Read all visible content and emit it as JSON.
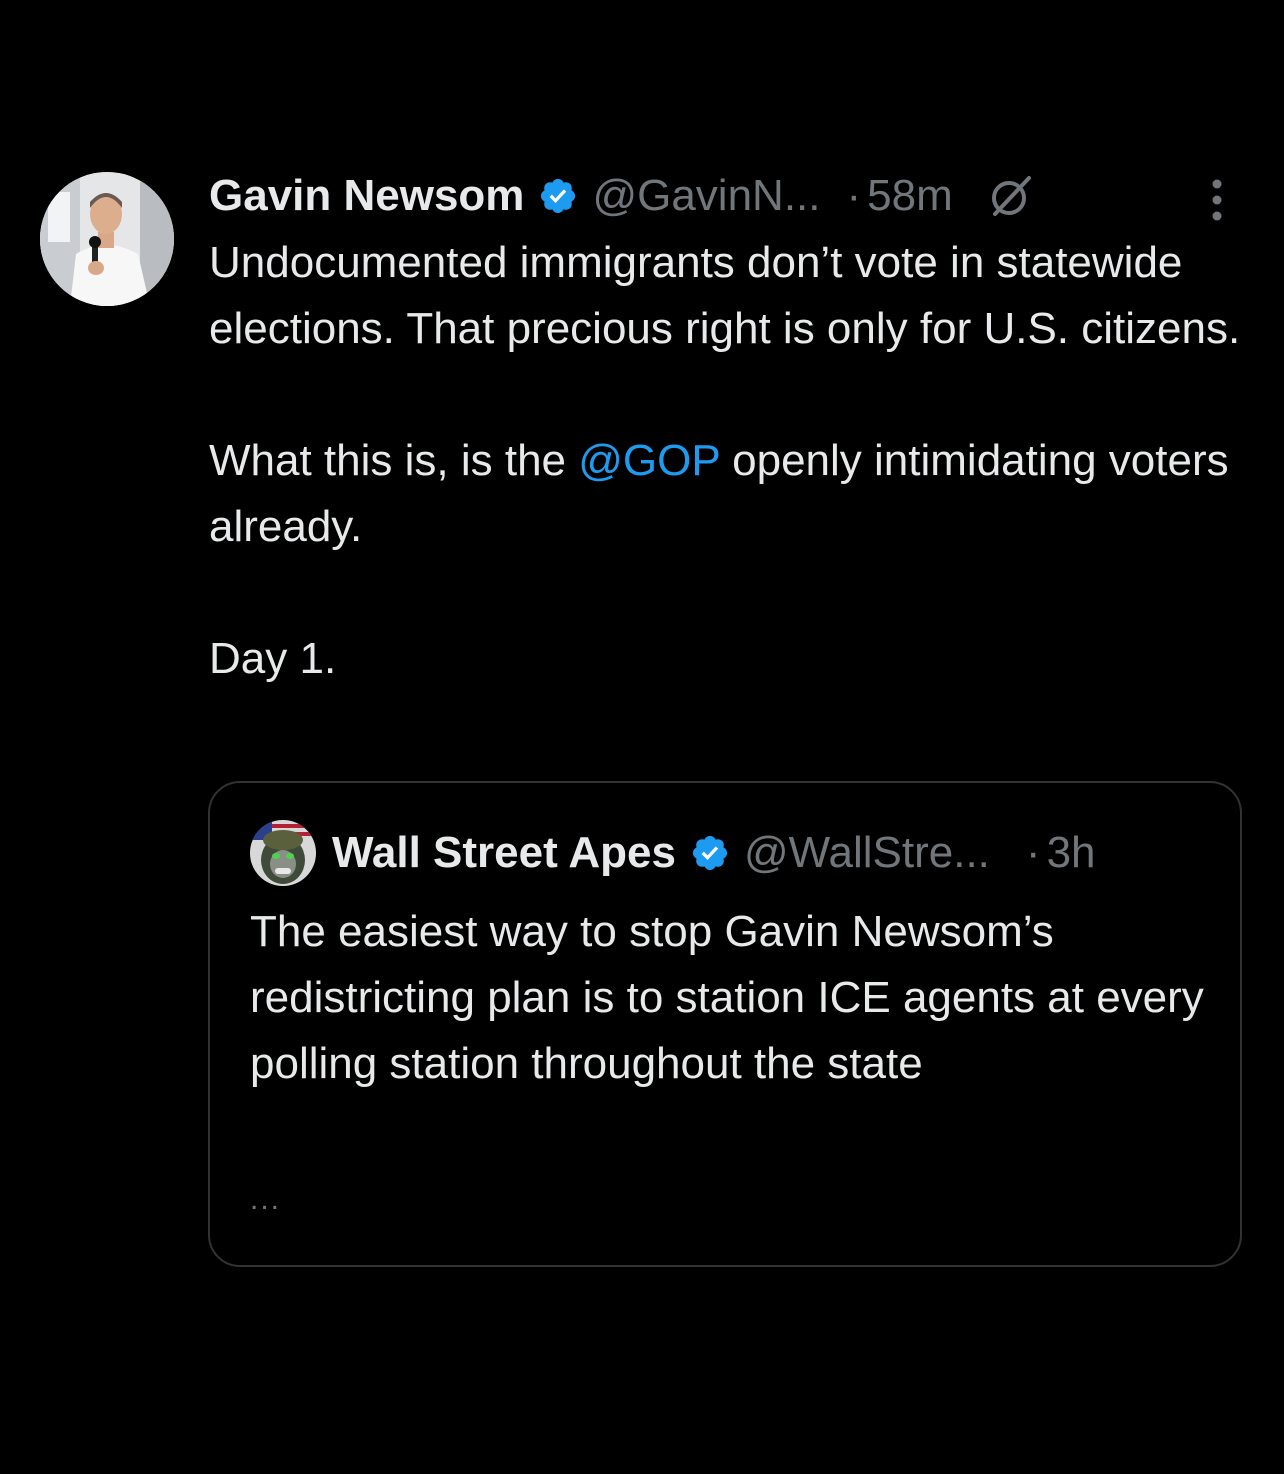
{
  "tweet": {
    "author_name": "Gavin Newsom",
    "author_handle": "@GavinN...",
    "separator": "·",
    "time": "58m",
    "body": {
      "paragraph1": "Undocumented immigrants don’t vote in statewide elections. That precious right is only for U.S. citizens.",
      "paragraph2_before": "What this is, is the ",
      "paragraph2_mention": "@GOP",
      "paragraph2_after": " openly intimidating voters already.",
      "paragraph3": "Day 1."
    },
    "icons": {
      "verified": "verified-badge-icon",
      "grok": "grok-icon",
      "more": "more-options-icon"
    }
  },
  "quoted_tweet": {
    "author_name": "Wall Street Apes",
    "author_handle": "@WallStre...",
    "separator": "·",
    "time": "3h",
    "body": "The easiest way to stop Gavin Newsom’s redistricting plan is to station ICE agents at every polling station throughout the state",
    "truncation": "..."
  },
  "colors": {
    "background": "#000000",
    "text": "#e7e9ea",
    "muted": "#71767b",
    "accent": "#1d9bf0",
    "border": "#2f3336"
  }
}
